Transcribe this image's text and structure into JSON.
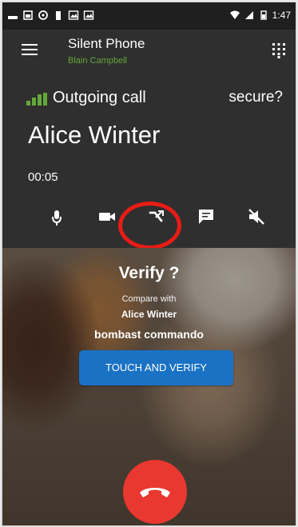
{
  "status_bar": {
    "time": "1:47",
    "left_icons": [
      "notification-icon",
      "image-icon",
      "circle-icon",
      "battery-saver-icon",
      "photo-icon",
      "photo-icon"
    ],
    "right_icons": [
      "wifi-icon",
      "signal-icon",
      "battery-icon"
    ]
  },
  "app_bar": {
    "title": "Silent Phone",
    "subtitle": "Blain Campbell",
    "left_icon": "menu-icon",
    "right_icon": "dialpad-icon"
  },
  "call": {
    "state_label": "Outgoing call",
    "security_label": "secure?",
    "contact_name": "Alice Winter",
    "duration": "00:05",
    "controls": [
      "microphone-icon",
      "video-icon",
      "transfer-icon",
      "chat-icon",
      "mute-icon"
    ]
  },
  "verify": {
    "title": "Verify ?",
    "compare_label": "Compare with",
    "compare_name": "Alice Winter",
    "sas_words": "bombast  commando",
    "button_label": "TOUCH AND VERIFY"
  },
  "colors": {
    "accent_green": "#65a83a",
    "accent_red": "#e9382f",
    "accent_blue": "#1a72c5",
    "bar_dark": "#2f2f2f"
  }
}
